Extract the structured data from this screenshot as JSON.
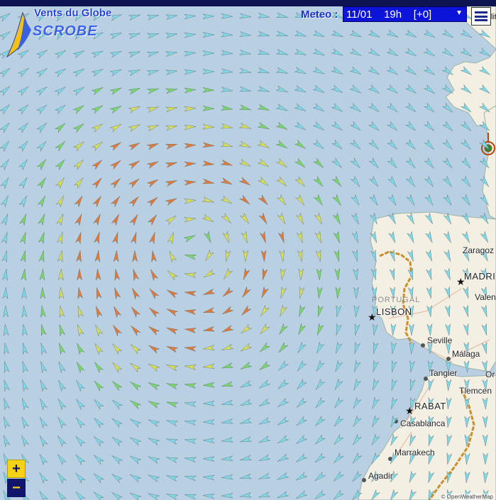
{
  "app": {
    "title": "Vents du Globe",
    "subtitle": "SCROBE"
  },
  "meteo": {
    "label": "Meteo :",
    "selected": "11/01    19h    [+0]"
  },
  "layers_fragment": "lit",
  "zoom": {
    "in_label": "+",
    "out_label": "−"
  },
  "cities": [
    {
      "name": "Zaragoz",
      "capital": false
    },
    {
      "name": "MADRI",
      "capital": true
    },
    {
      "name": "Valen",
      "capital": false
    },
    {
      "name": "LISBON",
      "capital": true
    },
    {
      "name": "Seville",
      "capital": false
    },
    {
      "name": "Málaga",
      "capital": false
    },
    {
      "name": "Tangier",
      "capital": false
    },
    {
      "name": "Or",
      "capital": false
    },
    {
      "name": "Tlemcen",
      "capital": false
    },
    {
      "name": "RABAT",
      "capital": true
    },
    {
      "name": "Casablanca",
      "capital": false
    },
    {
      "name": "Marrakech",
      "capital": false
    },
    {
      "name": "Agadir",
      "capital": false
    }
  ],
  "country_label": "PORTUGAL",
  "attribution": "© OpenWeatherMap",
  "colors": {
    "sea": "#b9cfe2",
    "land": "#f3efe3",
    "border": "#c8902a",
    "wind_weak": "#7fd9e6",
    "wind_moderate": "#79d86a",
    "wind_fresh": "#d8e05a",
    "wind_strong": "#e07a3a",
    "meteo_select": "#0b14d8",
    "header_bar": "#0d1450"
  }
}
